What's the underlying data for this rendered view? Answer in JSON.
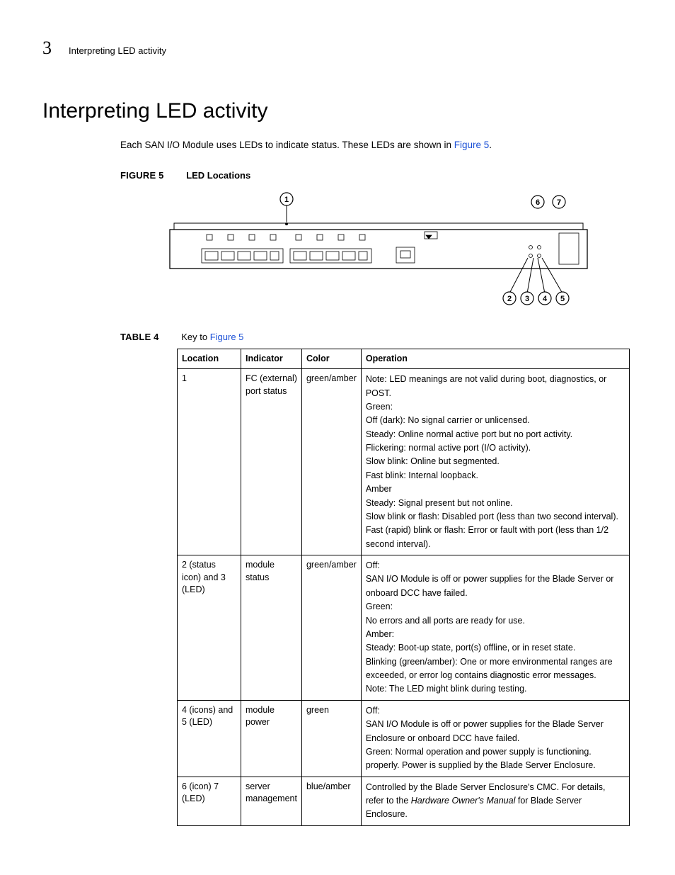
{
  "header": {
    "chapter": "3",
    "running": "Interpreting LED activity"
  },
  "title": "Interpreting LED activity",
  "intro_prefix": "Each SAN I/O Module uses LEDs to indicate status. These LEDs are shown in ",
  "intro_link": "Figure 5",
  "intro_suffix": ".",
  "figure": {
    "label": "FIGURE 5",
    "title": "LED Locations",
    "callouts": [
      "1",
      "2",
      "3",
      "4",
      "5",
      "6",
      "7"
    ]
  },
  "table": {
    "label": "TABLE 4",
    "title_prefix": "Key to ",
    "title_link": "Figure 5",
    "headers": [
      "Location",
      "Indicator",
      "Color",
      "Operation"
    ],
    "rows": [
      {
        "location": "1",
        "indicator": "FC (external) port status",
        "color": "green/amber",
        "operation": [
          "Note: LED meanings are not valid during boot, diagnostics, or POST.",
          "Green:",
          "Off (dark): No signal carrier or unlicensed.",
          "Steady: Online normal active port but no port activity.",
          "Flickering: normal active port (I/O activity).",
          "Slow blink: Online but segmented.",
          "Fast blink: Internal loopback.",
          "Amber",
          "Steady: Signal present but not online.",
          "Slow blink or flash: Disabled port (less than two second interval).",
          "Fast (rapid) blink or flash: Error or fault with port (less than 1/2 second interval)."
        ]
      },
      {
        "location": "2 (status icon) and 3 (LED)",
        "indicator": "module status",
        "color": "green/amber",
        "operation": [
          "Off:",
          "SAN I/O Module is off or power supplies for the Blade Server or onboard DCC have failed.",
          "Green:",
          "No errors and all ports are ready for use.",
          "Amber:",
          "Steady: Boot-up state, port(s) offline, or in reset state.",
          "Blinking (green/amber): One or more environmental ranges are exceeded, or error log contains diagnostic error messages.",
          "Note: The LED might blink during testing."
        ]
      },
      {
        "location": "4 (icons) and 5 (LED)",
        "indicator": "module power",
        "color": "green",
        "operation": [
          "Off:",
          "SAN I/O Module is off or power supplies for the Blade Server Enclosure or onboard DCC have failed.",
          "Green: Normal operation and power supply is functioning. properly. Power is supplied by the Blade Server Enclosure."
        ]
      },
      {
        "location": "6 (icon) 7 (LED)",
        "indicator": "server management",
        "color": "blue/amber",
        "operation_special": {
          "pre": "Controlled by the Blade Server Enclosure's CMC. For details, refer to the ",
          "italic": "Hardware Owner's Manual",
          "post": " for Blade Server Enclosure."
        }
      }
    ]
  }
}
